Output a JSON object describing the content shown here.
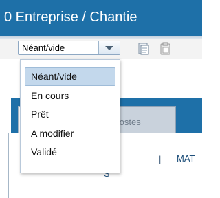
{
  "header": {
    "title": "0 Entreprise / Chantie"
  },
  "toolbar": {
    "status_select": {
      "value": "Néant/vide"
    }
  },
  "tabs": [
    {
      "label": ""
    },
    {
      "label": "Postes"
    }
  ],
  "content": {
    "separator": "|",
    "mat_text": "MAT",
    "stray_text": "S"
  },
  "dropdown": {
    "options": [
      {
        "label": "Néant/vide",
        "selected": true
      },
      {
        "label": "En cours"
      },
      {
        "label": "Prêt"
      },
      {
        "label": "A modifier"
      },
      {
        "label": "Validé"
      }
    ]
  },
  "colors": {
    "header_bg": "#1e70a8",
    "option_selected_bg": "#c3d8ec"
  }
}
